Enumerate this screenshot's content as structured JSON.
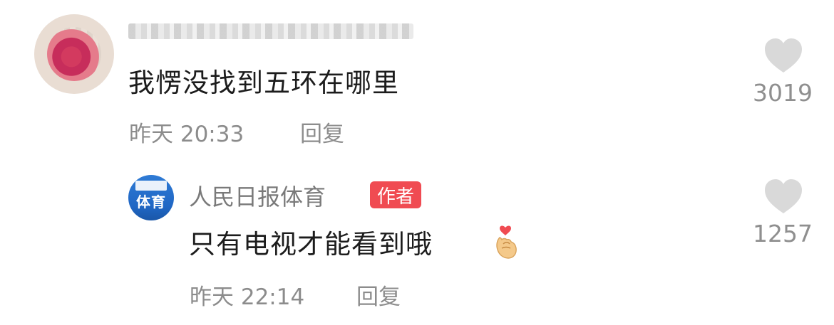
{
  "comment": {
    "username": "",
    "text": "我愣没找到五环在哪里",
    "time": "昨天 20:33",
    "reply_label": "回复",
    "likes": "3019"
  },
  "reply": {
    "author": "人民日报体育",
    "badge": "作者",
    "avatar_label": "体育",
    "text": "只有电视才能看到哦",
    "time": "昨天 22:14",
    "reply_label": "回复",
    "likes": "1257"
  },
  "colors": {
    "badge": "#f04b52",
    "meta": "#8c8c8c",
    "heart": "#d9d9d9"
  },
  "icons": {
    "heart": "heart-icon",
    "emoji": "finger-heart-emoji"
  }
}
